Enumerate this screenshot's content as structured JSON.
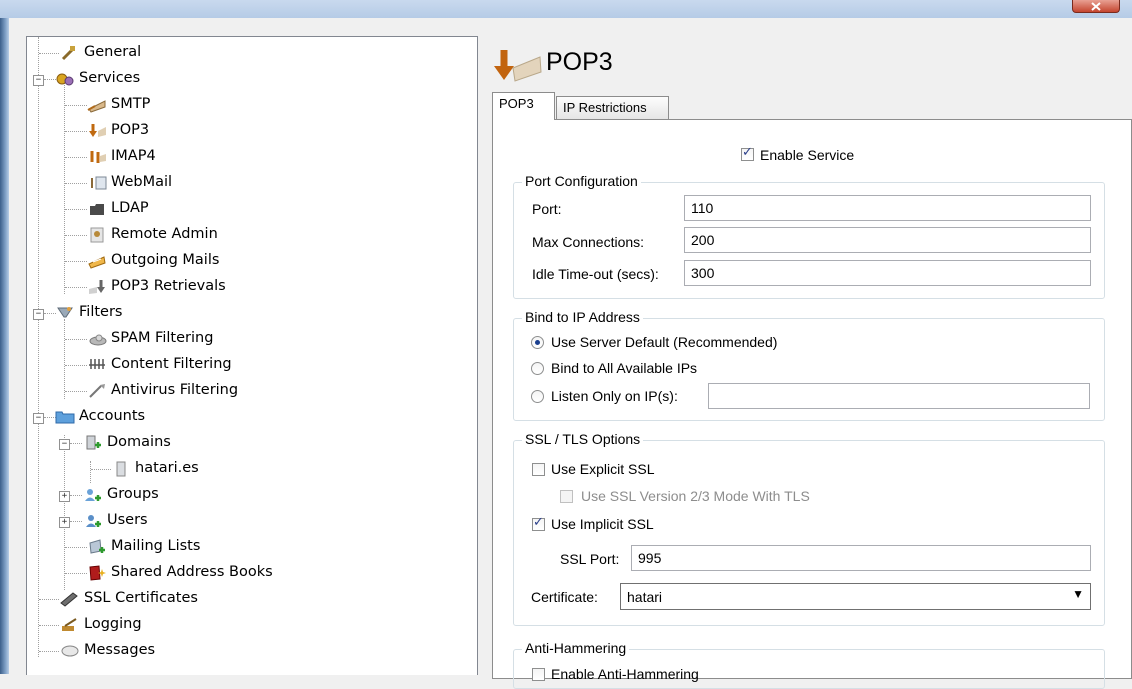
{
  "tree": {
    "items": [
      {
        "label": "General",
        "icon": "general-icon"
      },
      {
        "label": "Services",
        "icon": "services-icon"
      },
      {
        "label": "SMTP",
        "icon": "smtp-icon"
      },
      {
        "label": "POP3",
        "icon": "pop3-icon"
      },
      {
        "label": "IMAP4",
        "icon": "imap4-icon"
      },
      {
        "label": "WebMail",
        "icon": "webmail-icon"
      },
      {
        "label": "LDAP",
        "icon": "ldap-icon"
      },
      {
        "label": "Remote Admin",
        "icon": "remote-admin-icon"
      },
      {
        "label": "Outgoing Mails",
        "icon": "outgoing-mails-icon"
      },
      {
        "label": "POP3 Retrievals",
        "icon": "pop3-retrievals-icon"
      },
      {
        "label": "Filters",
        "icon": "filters-icon"
      },
      {
        "label": "SPAM Filtering",
        "icon": "spam-filtering-icon"
      },
      {
        "label": "Content Filtering",
        "icon": "content-filtering-icon"
      },
      {
        "label": "Antivirus Filtering",
        "icon": "antivirus-filtering-icon"
      },
      {
        "label": "Accounts",
        "icon": "folder-icon"
      },
      {
        "label": "Domains",
        "icon": "domains-icon"
      },
      {
        "label": "hatari.es",
        "icon": "domain-icon"
      },
      {
        "label": "Groups",
        "icon": "groups-icon"
      },
      {
        "label": "Users",
        "icon": "users-icon"
      },
      {
        "label": "Mailing Lists",
        "icon": "mailing-lists-icon"
      },
      {
        "label": "Shared Address Books",
        "icon": "address-book-icon"
      },
      {
        "label": "SSL Certificates",
        "icon": "certificate-icon"
      },
      {
        "label": "Logging",
        "icon": "logging-icon"
      },
      {
        "label": "Messages",
        "icon": "messages-icon"
      }
    ],
    "expanders": {
      "minus": "−",
      "plus": "+"
    }
  },
  "page": {
    "title": "POP3",
    "tabs": [
      "POP3",
      "IP Restrictions"
    ]
  },
  "form": {
    "enable_service": {
      "label": "Enable Service",
      "checked": true
    },
    "port_config": {
      "legend": "Port Configuration",
      "port_label": "Port:",
      "port_value": "110",
      "max_conn_label": "Max Connections:",
      "max_conn_value": "200",
      "idle_label": "Idle Time-out (secs):",
      "idle_value": "300"
    },
    "bind_ip": {
      "legend": "Bind to IP Address",
      "options": [
        "Use Server Default (Recommended)",
        "Bind to All Available IPs",
        "Listen Only on IP(s):"
      ],
      "selected": 0,
      "listen_ips_value": ""
    },
    "ssl": {
      "legend": "SSL / TLS Options",
      "explicit_label": "Use Explicit SSL",
      "explicit_checked": false,
      "ssl23_label": "Use SSL Version 2/3 Mode With TLS",
      "implicit_label": "Use Implicit SSL",
      "implicit_checked": true,
      "port_label": "SSL Port:",
      "port_value": "995",
      "certificate_label": "Certificate:",
      "certificate_value": "hatari"
    },
    "anti_hammering": {
      "legend": "Anti-Hammering",
      "enable_label": "Enable Anti-Hammering"
    }
  },
  "colors": {
    "titlebar": "#b5cbe6",
    "close": "#c4452f",
    "radio_dot": "#1a3f8f"
  }
}
